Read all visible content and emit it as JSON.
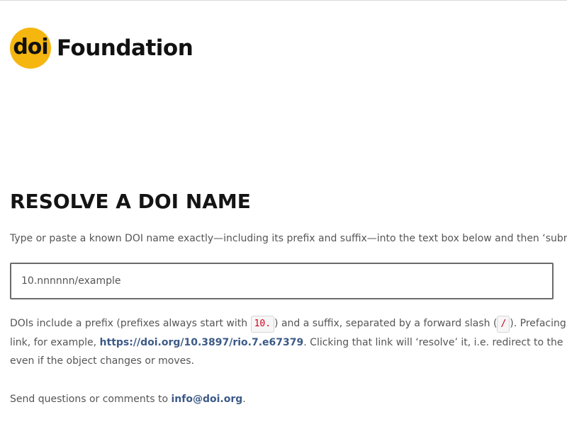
{
  "logo": {
    "badge_text": "doi",
    "wordmark": "Foundation",
    "badge_color": "#f5b60f"
  },
  "page_title": "RESOLVE A DOI NAME",
  "instructions": "Type or paste a known DOI name exactly—including its prefix and suffix—into the text box below and then ‘submit’ t",
  "search": {
    "placeholder": "10.nnnnnn/example"
  },
  "explanation": {
    "p1": "DOIs include a prefix (prefixes always start with ",
    "prefix_code": "10.",
    "p2": ") and a suffix, separated by a forward slash (",
    "slash_code": "/",
    "p3": "). Prefacing the ",
    "p4": "link, for example, ",
    "example_link": "https://doi.org/10.3897/rio.7.e67379",
    "p5": ". Clicking that link will ‘resolve’ it, i.e. redirect to the",
    "p6": "even if the object changes or moves."
  },
  "contact": {
    "text": "Send questions or comments to ",
    "email": "info@doi.org",
    "end": "."
  },
  "colors": {
    "link": "#3c5a86",
    "code": "#d0021b"
  }
}
